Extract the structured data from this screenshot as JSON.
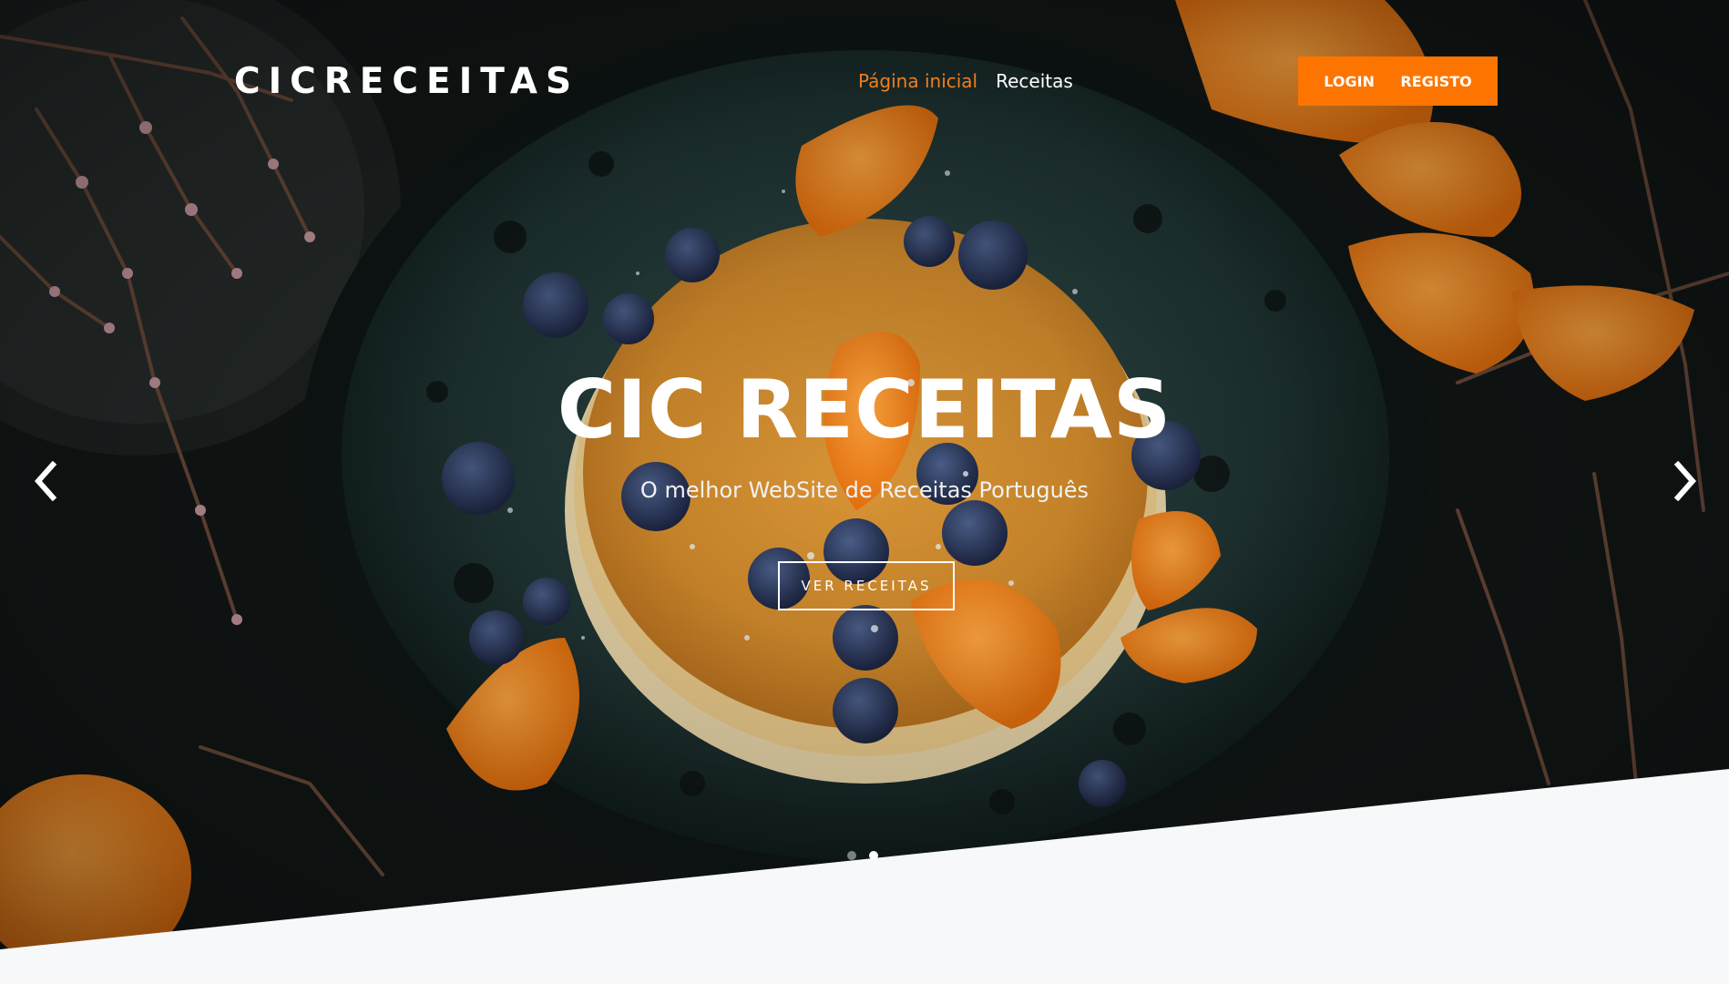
{
  "header": {
    "brand": "CICRECEITAS",
    "nav": [
      {
        "label": "Página inicial",
        "active": true
      },
      {
        "label": "Receitas",
        "active": false
      }
    ],
    "auth": {
      "login_label": "LOGIN",
      "register_label": "REGISTO"
    }
  },
  "hero": {
    "title": "CIC RECEITAS",
    "subtitle": "O melhor WebSite de Receitas Português",
    "cta_label": "VER RECEITAS",
    "prev_icon": "chevron-left-icon",
    "next_icon": "chevron-right-icon",
    "slides_count": 2,
    "active_slide": 2
  },
  "colors": {
    "accent": "#fd7500",
    "active_nav": "#f07e1d",
    "page_background": "#f7f8fa"
  }
}
